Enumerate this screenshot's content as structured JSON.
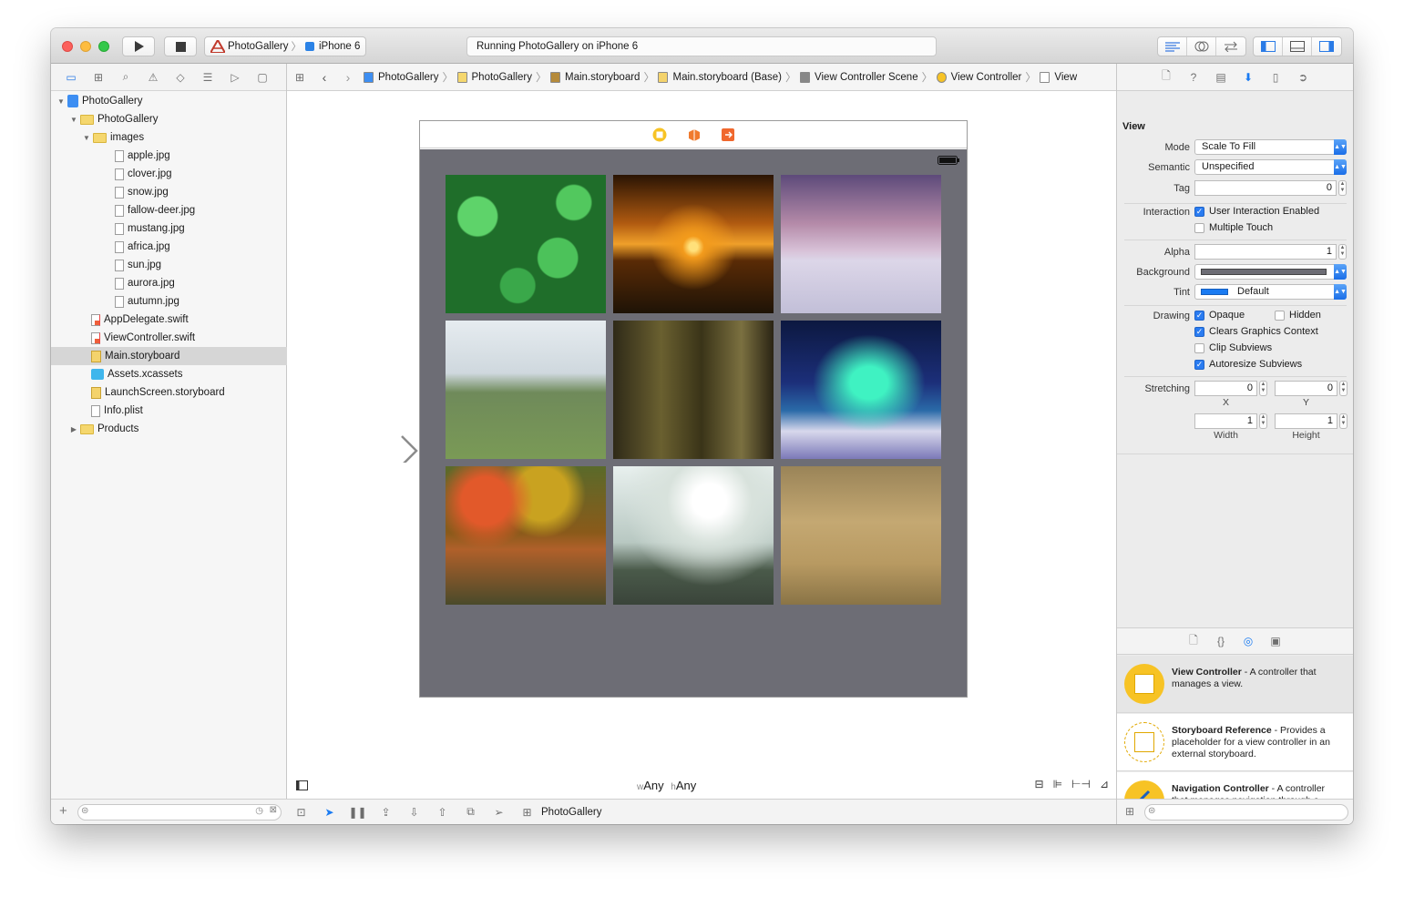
{
  "toolbar": {
    "scheme_app": "PhotoGallery",
    "scheme_device": "iPhone 6",
    "status_text": "Running PhotoGallery on iPhone 6"
  },
  "navigator": {
    "tree": [
      {
        "label": "PhotoGallery",
        "depth": 0,
        "icon": "project-icon",
        "disclosure": "open"
      },
      {
        "label": "PhotoGallery",
        "depth": 1,
        "icon": "folder-icon",
        "disclosure": "open"
      },
      {
        "label": "images",
        "depth": 2,
        "icon": "folder-icon",
        "disclosure": "open"
      },
      {
        "label": "apple.jpg",
        "depth": 3,
        "icon": "image-file-icon"
      },
      {
        "label": "clover.jpg",
        "depth": 3,
        "icon": "image-file-icon"
      },
      {
        "label": "snow.jpg",
        "depth": 3,
        "icon": "image-file-icon"
      },
      {
        "label": "fallow-deer.jpg",
        "depth": 3,
        "icon": "image-file-icon"
      },
      {
        "label": "mustang.jpg",
        "depth": 3,
        "icon": "image-file-icon"
      },
      {
        "label": "africa.jpg",
        "depth": 3,
        "icon": "image-file-icon"
      },
      {
        "label": "sun.jpg",
        "depth": 3,
        "icon": "image-file-icon"
      },
      {
        "label": "aurora.jpg",
        "depth": 3,
        "icon": "image-file-icon"
      },
      {
        "label": "autumn.jpg",
        "depth": 3,
        "icon": "image-file-icon"
      },
      {
        "label": "AppDelegate.swift",
        "depth": 2,
        "icon": "swift-file-icon"
      },
      {
        "label": "ViewController.swift",
        "depth": 2,
        "icon": "swift-file-icon"
      },
      {
        "label": "Main.storyboard",
        "depth": 2,
        "icon": "storyboard-icon",
        "selected": true
      },
      {
        "label": "Assets.xcassets",
        "depth": 2,
        "icon": "asset-catalog-icon"
      },
      {
        "label": "LaunchScreen.storyboard",
        "depth": 2,
        "icon": "storyboard-icon"
      },
      {
        "label": "Info.plist",
        "depth": 2,
        "icon": "plist-file-icon"
      },
      {
        "label": "Products",
        "depth": 1,
        "icon": "folder-icon",
        "disclosure": "closed"
      }
    ]
  },
  "jumpbar": {
    "crumbs": [
      "PhotoGallery",
      "PhotoGallery",
      "Main.storyboard",
      "Main.storyboard (Base)",
      "View Controller Scene",
      "View Controller",
      "View"
    ]
  },
  "canvas": {
    "size_w_prefix": "w",
    "size_w": "Any",
    "size_h_prefix": "h",
    "size_h": "Any",
    "photos": [
      "clover",
      "sun",
      "snow",
      "mustang",
      "fallow-deer",
      "aurora",
      "autumn",
      "apple",
      "africa"
    ]
  },
  "debugbar": {
    "target": "PhotoGallery"
  },
  "inspector": {
    "section_title": "View",
    "mode_label": "Mode",
    "mode_value": "Scale To Fill",
    "semantic_label": "Semantic",
    "semantic_value": "Unspecified",
    "tag_label": "Tag",
    "tag_value": "0",
    "interaction_label": "Interaction",
    "user_interaction": "User Interaction Enabled",
    "multiple_touch": "Multiple Touch",
    "alpha_label": "Alpha",
    "alpha_value": "1",
    "background_label": "Background",
    "tint_label": "Tint",
    "tint_value": "Default",
    "drawing_label": "Drawing",
    "opaque": "Opaque",
    "hidden": "Hidden",
    "clears_graphics": "Clears Graphics Context",
    "clip_subviews": "Clip Subviews",
    "autoresize_subviews": "Autoresize Subviews",
    "stretching_label": "Stretching",
    "stretch_x": "0",
    "stretch_y": "0",
    "stretch_w": "1",
    "stretch_h": "1",
    "x_label": "X",
    "y_label": "Y",
    "width_label": "Width",
    "height_label": "Height",
    "colors": {
      "background_swatch": "#6d6d75",
      "tint_swatch": "#1a7bf2",
      "accent": "#2a7cf1"
    }
  },
  "library": {
    "items": [
      {
        "title": "View Controller",
        "desc": " - A controller that manages a view."
      },
      {
        "title": "Storyboard Reference",
        "desc": " - Provides a placeholder for a view controller in an external storyboard."
      },
      {
        "title": "Navigation Controller",
        "desc": " - A controller that manages navigation through a hierarchy of views."
      }
    ]
  }
}
